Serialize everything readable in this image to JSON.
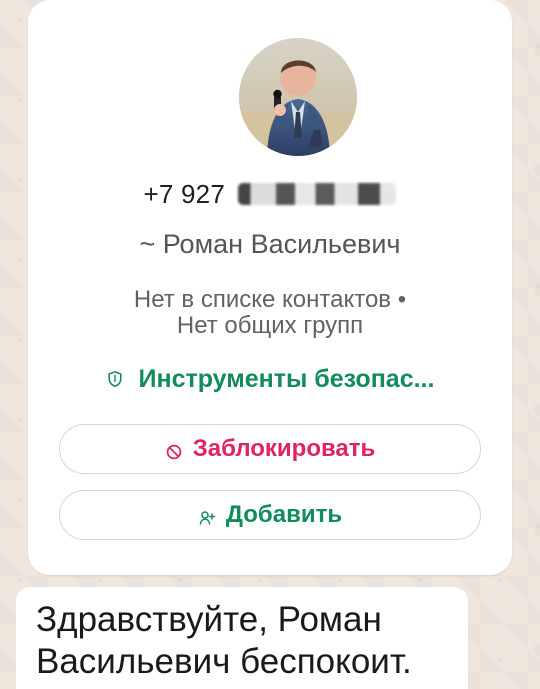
{
  "contact": {
    "phone_prefix": "+7 927",
    "display_name": "~ Роман Васильевич",
    "status_line_1": "Нет в списке контактов •",
    "status_line_2": "Нет общих групп",
    "security_label": "Инструменты безопас...",
    "block_label": "Заблокировать",
    "add_label": "Добавить"
  },
  "message": {
    "line_1": "Здравствуйте, Роман",
    "line_2": "Васильевич беспокоит."
  },
  "colors": {
    "security": "#128c5a",
    "block": "#e0245e",
    "add": "#128c5a"
  },
  "icons": {
    "security": "shield-icon",
    "block": "block-icon",
    "add": "add-contact-icon",
    "avatar": "avatar"
  }
}
